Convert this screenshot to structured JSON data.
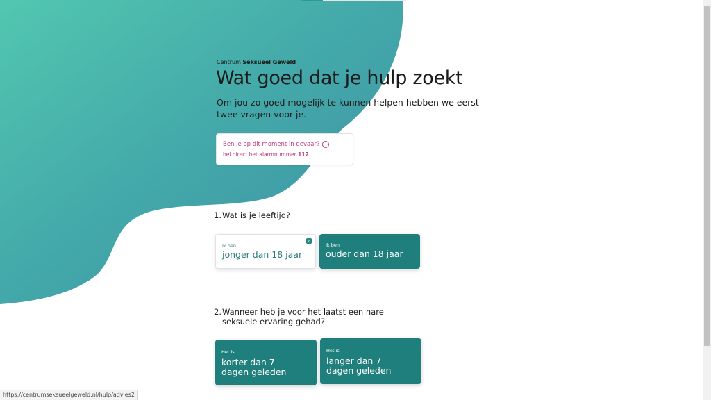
{
  "brand": {
    "prefix": "Centrum",
    "name": "Seksueel Geweld"
  },
  "page": {
    "title": "Wat goed dat je hulp zoekt",
    "intro": "Om jou zo goed mogelijk te kunnen helpen hebben we eerst twee vragen voor je."
  },
  "alarm": {
    "question": "Ben je op dit moment in gevaar?",
    "icon": "info-icon",
    "text_prefix": "bel direct het alarmnummer",
    "number": "112",
    "color": "#c2357c"
  },
  "questions": [
    {
      "number": "1.",
      "text": "Wat is je leeftijd?",
      "options": [
        {
          "pre": "Ik ben",
          "label": "jonger dan 18 jaar",
          "selected": true
        },
        {
          "pre": "Ik ben",
          "label": "ouder dan 18 jaar",
          "selected": false
        }
      ]
    },
    {
      "number": "2.",
      "text": "Wanneer heb je voor het laatst een nare seksuele ervaring gehad?",
      "options": [
        {
          "pre": "Het is",
          "label": "korter dan 7 dagen geleden",
          "selected": false
        },
        {
          "pre": "Het is",
          "label": "langer dan 7 dagen geleden",
          "selected": false
        }
      ]
    }
  ],
  "status_url": "https://centrumseksueelgeweld.nl/hulp/advies2",
  "colors": {
    "teal": "#1f7f7c",
    "teal_light": "#4fc4b2",
    "accent_pink": "#c2357c"
  }
}
